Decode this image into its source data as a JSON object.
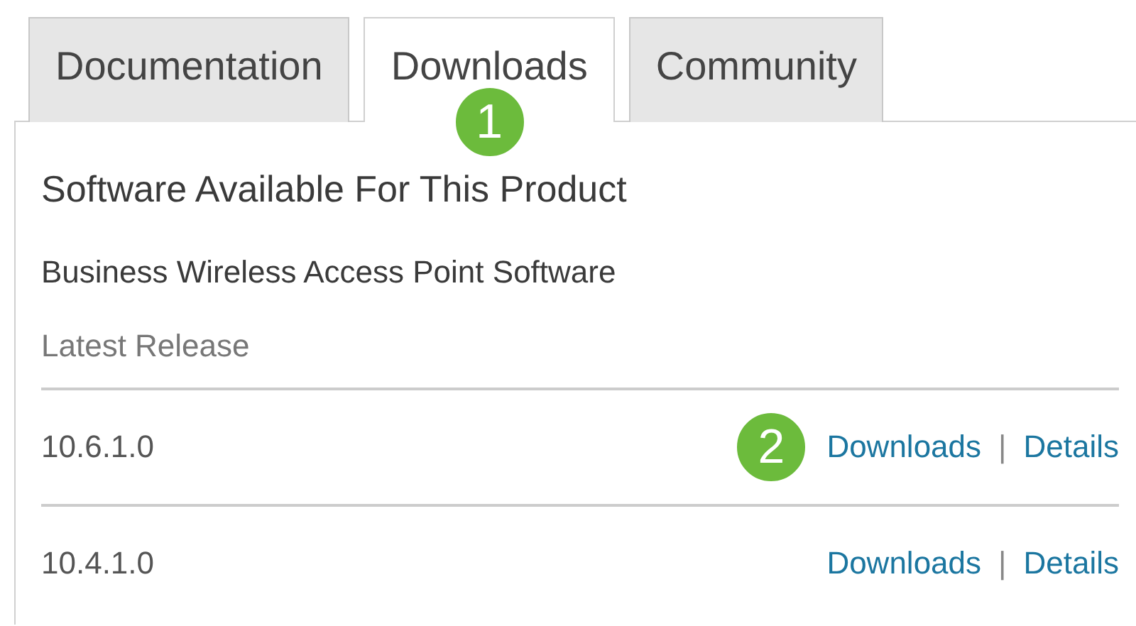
{
  "tabs": [
    {
      "label": "Documentation",
      "selected": false
    },
    {
      "label": "Downloads",
      "selected": true,
      "callout": "1"
    },
    {
      "label": "Community",
      "selected": false
    }
  ],
  "panel": {
    "title": "Software Available For This Product",
    "product": "Business Wireless Access Point Software",
    "section": "Latest Release",
    "releases": [
      {
        "version": "10.6.1.0",
        "callout": "2",
        "links": [
          "Downloads",
          "|",
          "Details"
        ]
      },
      {
        "version": "10.4.1.0",
        "links": [
          "Downloads",
          "|",
          "Details"
        ]
      }
    ]
  }
}
